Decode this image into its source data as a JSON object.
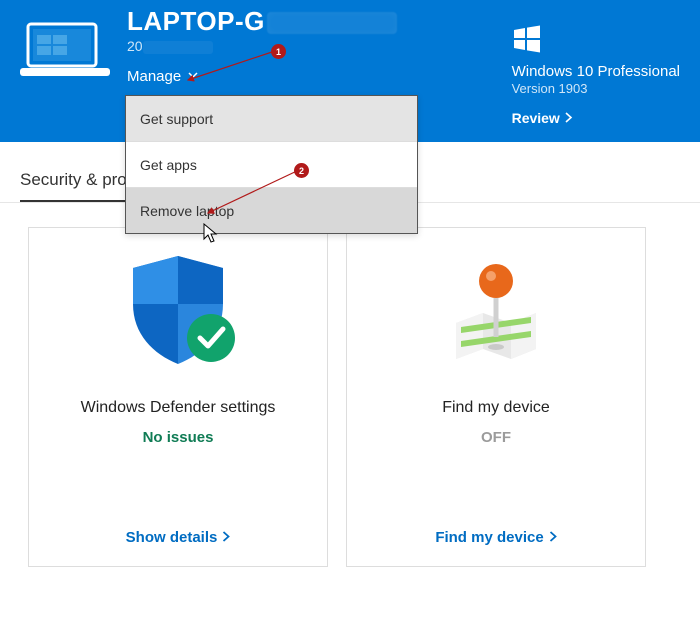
{
  "header": {
    "deviceNamePrefix": "LAPTOP-G",
    "deviceSubPrefix": "20",
    "manageLabel": "Manage"
  },
  "os": {
    "name": "Windows 10 Professional",
    "version": "Version 1903",
    "reviewLabel": "Review"
  },
  "manageMenu": {
    "items": [
      {
        "label": "Get support"
      },
      {
        "label": "Get apps"
      },
      {
        "label": "Remove laptop"
      }
    ]
  },
  "tabs": {
    "security": "Security & protection"
  },
  "cards": {
    "defender": {
      "title": "Windows Defender settings",
      "status": "No issues",
      "link": "Show details"
    },
    "findDevice": {
      "title": "Find my device",
      "status": "OFF",
      "link": "Find my device"
    }
  },
  "annotations": {
    "badge1": "1",
    "badge2": "2"
  }
}
